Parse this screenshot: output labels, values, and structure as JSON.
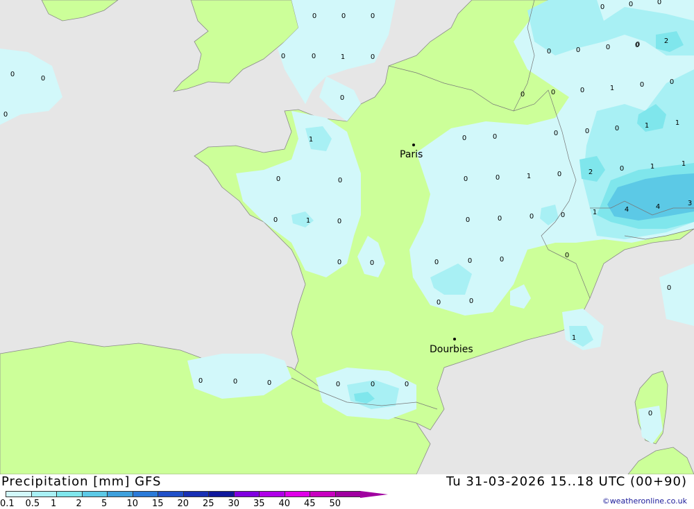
{
  "title": "Precipitation [mm] GFS",
  "time_info": "Tu 31-03-2026 15..18 UTC (00+90)",
  "credit": "©weatheronline.co.uk",
  "colors": {
    "sea": "#e6e6e6",
    "land": "#ccff99",
    "precip_0_1": "#d2f8fa",
    "precip_0_5": "#a8f0f4",
    "precip_1": "#7fe6ec",
    "precip_2": "#5cc9e6",
    "precip_5": "#3ea0dc"
  },
  "legend": {
    "labels": [
      "0.1",
      "0.5",
      "1",
      "2",
      "5",
      "10",
      "15",
      "20",
      "25",
      "30",
      "35",
      "40",
      "45",
      "50"
    ],
    "colors": [
      "#d2f8fa",
      "#a8f0f4",
      "#7fe6ec",
      "#5cc9e6",
      "#3ea0dc",
      "#2a7ad8",
      "#2050c8",
      "#1830b4",
      "#10189c",
      "#8000e0",
      "#b000e8",
      "#e000e8",
      "#c800c0",
      "#a000a0"
    ]
  },
  "cities": [
    {
      "name": "Paris"
    },
    {
      "name": "Dourbies"
    }
  ],
  "grid_values": [
    "0",
    "0",
    "0",
    "0",
    "0",
    "1",
    "0",
    "0",
    "0",
    "0",
    "0",
    "0",
    "0",
    "0",
    "0",
    "0",
    "0",
    "0",
    "0",
    "2",
    "0",
    "0",
    "0",
    "0",
    "0",
    "0",
    "0",
    "1",
    "0",
    "0",
    "0",
    "0",
    "0",
    "1",
    "1",
    "1",
    "0",
    "0",
    "0",
    "0",
    "1",
    "0",
    "2",
    "0",
    "1",
    "1",
    "0",
    "0",
    "0",
    "0",
    "0",
    "1",
    "4",
    "4",
    "3",
    "0",
    "1",
    "0",
    "0",
    "0",
    "0",
    "0",
    "0",
    "0",
    "0",
    "0",
    "0",
    "0",
    "1",
    "0",
    "0",
    "0",
    "0",
    "0",
    "0",
    "0",
    "0",
    "0"
  ]
}
